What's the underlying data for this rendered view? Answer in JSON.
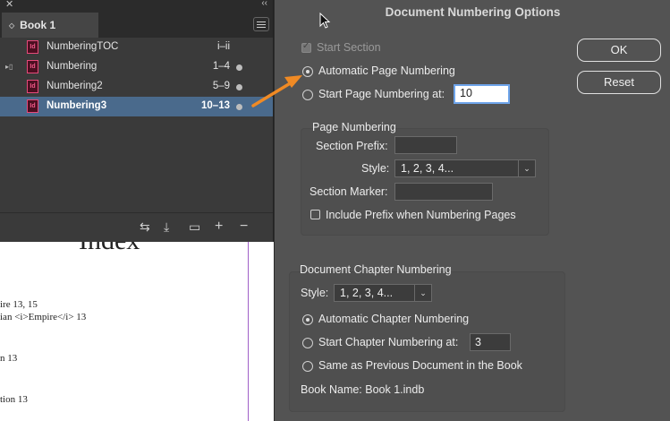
{
  "document": {
    "heading": "Index",
    "lines": [
      "ire  13, 15",
      "ian <i>Empire</i>  13",
      "n  13",
      "tion  13"
    ]
  },
  "book_panel": {
    "tab_title": "Book 1",
    "rows": [
      {
        "name": "NumberingTOC",
        "pages": "i–ii",
        "dot": false,
        "sync": false,
        "selected": false
      },
      {
        "name": "Numbering",
        "pages": "1–4",
        "dot": true,
        "sync": true,
        "selected": false
      },
      {
        "name": "Numbering2",
        "pages": "5–9",
        "dot": true,
        "sync": false,
        "selected": false
      },
      {
        "name": "Numbering3",
        "pages": "10–13",
        "dot": true,
        "sync": false,
        "selected": true
      }
    ],
    "doc_icon_label": "Id",
    "footer_icons": [
      "synchronize-icon",
      "save-icon",
      "print-icon",
      "add-icon",
      "remove-icon"
    ]
  },
  "dialog": {
    "title": "Document Numbering Options",
    "start_section_label": "Start Section",
    "auto_page_label": "Automatic Page Numbering",
    "start_page_label": "Start Page Numbering at:",
    "start_page_value": "10",
    "page_numbering_group": "Page Numbering",
    "section_prefix_label": "Section Prefix:",
    "section_prefix_value": "",
    "style_label": "Style:",
    "style_value": "1, 2, 3, 4...",
    "section_marker_label": "Section Marker:",
    "section_marker_value": "",
    "include_prefix_label": "Include Prefix when Numbering Pages",
    "chapter_group": "Document Chapter Numbering",
    "chapter_style_label": "Style:",
    "chapter_style_value": "1, 2, 3, 4...",
    "auto_chapter_label": "Automatic Chapter Numbering",
    "start_chapter_label": "Start Chapter Numbering at:",
    "start_chapter_value": "3",
    "same_as_prev_label": "Same as Previous Document in the Book",
    "book_name_label": "Book Name: Book 1.indb",
    "ok_label": "OK",
    "reset_label": "Reset"
  },
  "colors": {
    "annotation_arrow": "#f08a24",
    "selection": "#4a6a8c",
    "focus": "#6ea4ea"
  }
}
